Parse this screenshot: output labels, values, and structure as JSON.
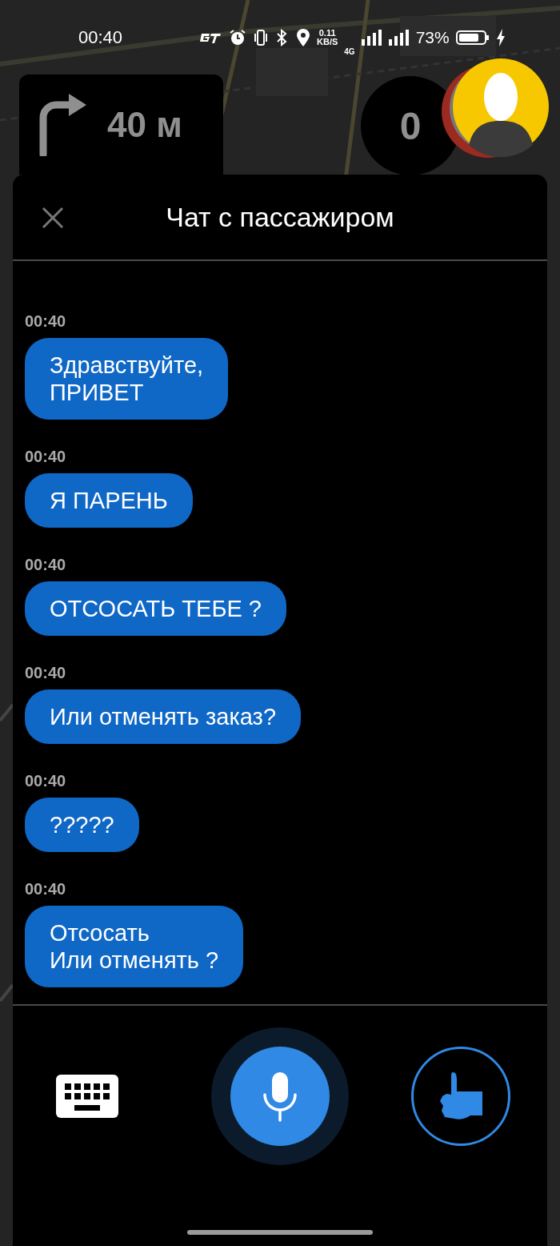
{
  "status_bar": {
    "time": "00:40",
    "speed_value": "0.11",
    "speed_unit": "KB/S",
    "network": "4G",
    "battery": "73%"
  },
  "navigation": {
    "distance": "40 м"
  },
  "speedometer": {
    "value": "0"
  },
  "chat": {
    "title": "Чат с пассажиром",
    "messages": [
      {
        "time": "00:40",
        "text": "Здравствуйте,\nПРИВЕТ"
      },
      {
        "time": "00:40",
        "text": "Я ПАРЕНЬ"
      },
      {
        "time": "00:40",
        "text": "ОТСОСАТЬ ТЕБЕ ?"
      },
      {
        "time": "00:40",
        "text": "Или отменять заказ?"
      },
      {
        "time": "00:40",
        "text": "?????"
      },
      {
        "time": "00:40",
        "text": "Отсосать\nИли отменять ?"
      }
    ]
  }
}
